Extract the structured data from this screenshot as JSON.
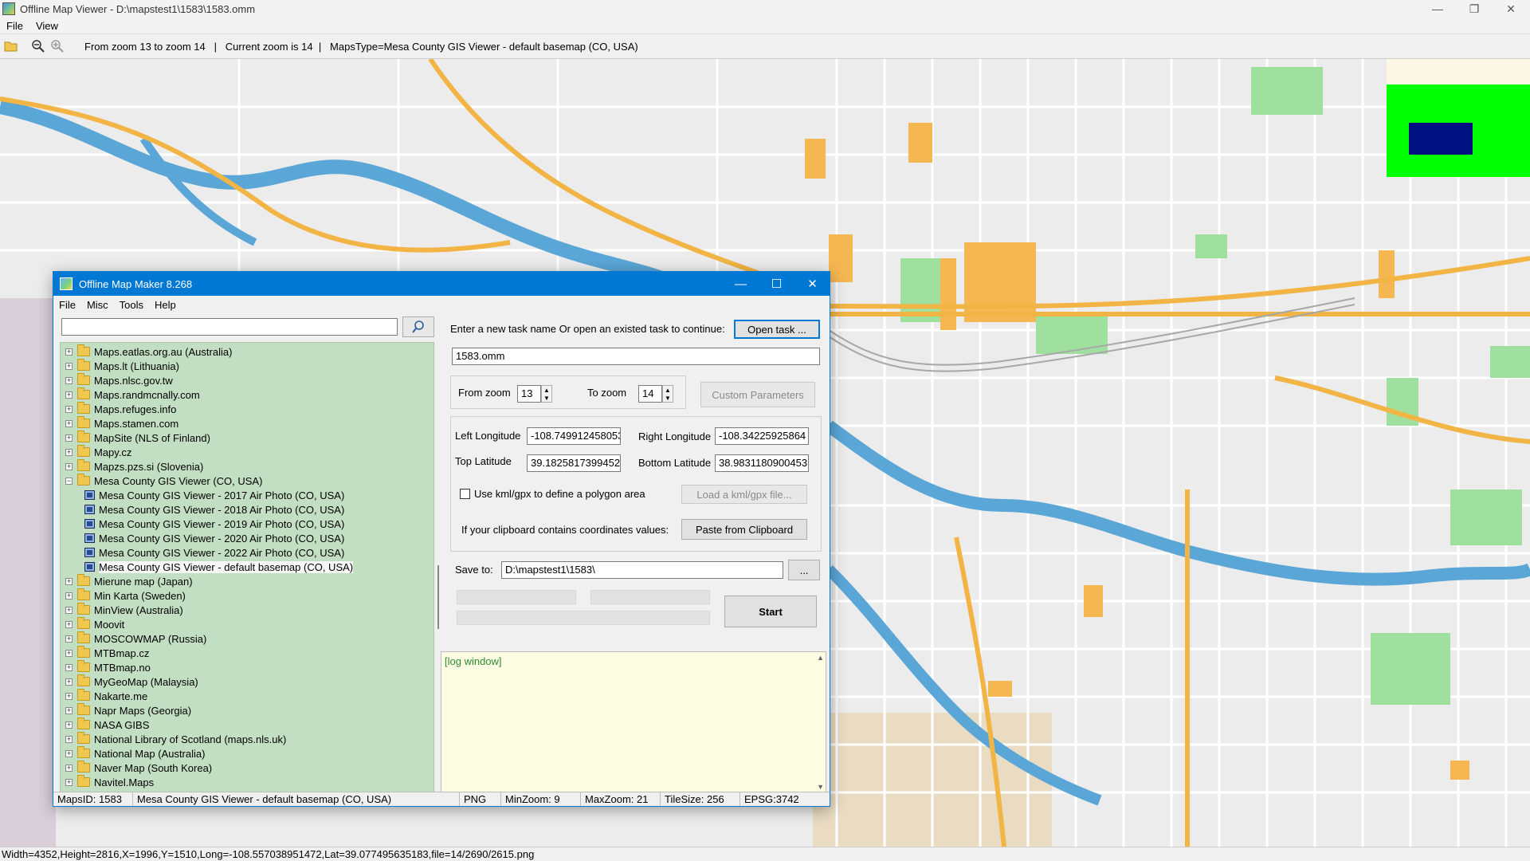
{
  "outer_window": {
    "title": "Offline Map Viewer - D:\\mapstest1\\1583\\1583.omm",
    "menu": [
      "File",
      "View"
    ],
    "toolbar_info": "From zoom 13 to zoom 14   |   Current zoom is 14  |   MapsType=Mesa County GIS Viewer - default basemap (CO, USA)",
    "status": "Width=4352,Height=2816,X=1996,Y=1510,Long=-108.557038951472,Lat=39.077495635183,file=14/2690/2615.png",
    "icons": {
      "open": "folder-open-icon",
      "zoom_out": "zoom-out-icon",
      "zoom_in": "zoom-in-icon",
      "minimize": "minimize-icon",
      "maximize": "maximize-icon",
      "close": "close-icon"
    }
  },
  "map": {
    "colors": {
      "background": "#ececec",
      "river": "#5aa6d6",
      "highway": "#f2b444",
      "park": "#9fe09f",
      "building": "#f5b752",
      "overview_green": "#00ff00",
      "overview_navy": "#001080"
    }
  },
  "dialog": {
    "title": "Offline Map Maker 8.268",
    "menu": [
      "File",
      "Misc",
      "Tools",
      "Help"
    ],
    "search": {
      "value": "",
      "placeholder": ""
    },
    "tree_items": [
      {
        "label": "Maps.eatlas.org.au (Australia)",
        "type": "folder"
      },
      {
        "label": "Maps.lt (Lithuania)",
        "type": "folder"
      },
      {
        "label": "Maps.nlsc.gov.tw",
        "type": "folder"
      },
      {
        "label": "Maps.randmcnally.com",
        "type": "folder"
      },
      {
        "label": "Maps.refuges.info",
        "type": "folder"
      },
      {
        "label": "Maps.stamen.com",
        "type": "folder"
      },
      {
        "label": "MapSite (NLS of Finland)",
        "type": "folder"
      },
      {
        "label": "Mapy.cz",
        "type": "folder"
      },
      {
        "label": "Mapzs.pzs.si (Slovenia)",
        "type": "folder"
      },
      {
        "label": "Mesa County GIS Viewer (CO, USA)",
        "type": "folder-open"
      },
      {
        "label": "Mesa County GIS Viewer - 2017 Air Photo (CO, USA)",
        "type": "map"
      },
      {
        "label": "Mesa County GIS Viewer - 2018 Air Photo (CO, USA)",
        "type": "map"
      },
      {
        "label": "Mesa County GIS Viewer - 2019 Air Photo (CO, USA)",
        "type": "map"
      },
      {
        "label": "Mesa County GIS Viewer - 2020 Air Photo (CO, USA)",
        "type": "map"
      },
      {
        "label": "Mesa County GIS Viewer - 2022 Air Photo (CO, USA)",
        "type": "map"
      },
      {
        "label": "Mesa County GIS Viewer - default basemap (CO, USA)",
        "type": "map",
        "selected": true
      },
      {
        "label": "Mierune map (Japan)",
        "type": "folder"
      },
      {
        "label": "Min Karta (Sweden)",
        "type": "folder"
      },
      {
        "label": "MinView (Australia)",
        "type": "folder"
      },
      {
        "label": "Moovit",
        "type": "folder"
      },
      {
        "label": "MOSCOWMAP (Russia)",
        "type": "folder"
      },
      {
        "label": "MTBmap.cz",
        "type": "folder"
      },
      {
        "label": "MTBmap.no",
        "type": "folder"
      },
      {
        "label": "MyGeoMap (Malaysia)",
        "type": "folder"
      },
      {
        "label": "Nakarte.me",
        "type": "folder"
      },
      {
        "label": "Napr Maps (Georgia)",
        "type": "folder"
      },
      {
        "label": "NASA GIBS",
        "type": "folder"
      },
      {
        "label": "National Library of Scotland (maps.nls.uk)",
        "type": "folder"
      },
      {
        "label": "National Map (Australia)",
        "type": "folder"
      },
      {
        "label": "Naver Map (South Korea)",
        "type": "folder"
      },
      {
        "label": "Navitel.Maps",
        "type": "folder"
      }
    ],
    "task": {
      "prompt": "Enter a new task name Or open an existed task to continue:",
      "open_button": "Open task ...",
      "name_value": "1583.omm"
    },
    "zoom": {
      "from_label": "From zoom",
      "from_value": "13",
      "to_label": "To zoom",
      "to_value": "14",
      "custom_button": "Custom Parameters"
    },
    "coords": {
      "left_lon_label": "Left Longitude",
      "left_lon_value": "-108.749912458053",
      "right_lon_label": "Right Longitude",
      "right_lon_value": "-108.34225925864",
      "top_lat_label": "Top Latitude",
      "top_lat_value": "39.1825817399452",
      "bottom_lat_label": "Bottom Latitude",
      "bottom_lat_value": "38.9831180900453",
      "kml_label": "Use kml/gpx to define a polygon area",
      "kml_button": "Load a kml/gpx file...",
      "clipboard_label": "If your clipboard contains coordinates values:",
      "clipboard_button": "Paste from Clipboard"
    },
    "save": {
      "label": "Save to:",
      "value": "D:\\mapstest1\\1583\\",
      "browse_button": "...",
      "start_button": "Start"
    },
    "log": {
      "text": "[log window]",
      "color": "#2e8b2e"
    },
    "status": {
      "maps_id": "MapsID: 1583",
      "map_name": "Mesa County GIS Viewer - default basemap (CO, USA)",
      "format": "PNG",
      "min_zoom": "MinZoom: 9",
      "max_zoom": "MaxZoom: 21",
      "tile_size": "TileSize: 256",
      "epsg": "EPSG:3742"
    }
  }
}
